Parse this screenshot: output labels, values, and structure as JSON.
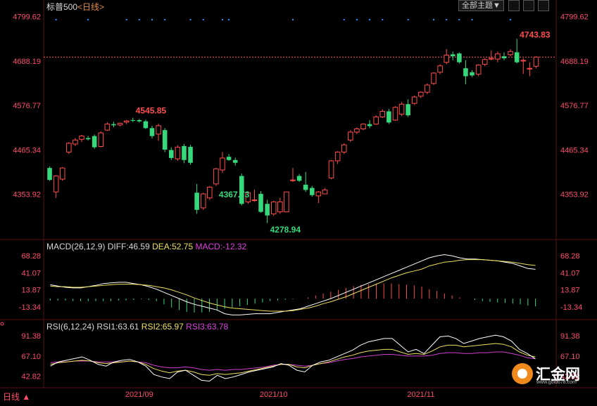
{
  "header": {
    "symbol": "标普500",
    "period_link": "<日线>",
    "theme_button": "全部主题▼"
  },
  "toolbar_icons": [
    "grid-icon",
    "settings-icon",
    "chart-icon"
  ],
  "price_panel": {
    "y_labels": [
      "4799.62",
      "4688.19",
      "4576.77",
      "4465.34",
      "4353.92"
    ],
    "annotations": {
      "high_1": "4545.85",
      "low_1": "4367.73",
      "low_2": "4278.94",
      "high_2": "4743.83"
    }
  },
  "macd_panel": {
    "title": "MACD(26,12,9)",
    "diff": "DIFF:46.59",
    "dea": "DEA:52.75",
    "macd": "MACD:-12.32",
    "y_labels": [
      "68.28",
      "41.07",
      "13.87",
      "-13.34"
    ]
  },
  "rsi_panel": {
    "title": "RSI(6,12,24)",
    "rsi1": "RSI1:63.61",
    "rsi2": "RSI2:65.97",
    "rsi3": "RSI3:63.78",
    "y_labels": [
      "91.38",
      "67.10",
      "42.82"
    ]
  },
  "x_axis": {
    "period": "日线",
    "labels": [
      "2021/09",
      "2021/10",
      "2021/11"
    ]
  },
  "watermark": {
    "name": "汇金网",
    "url": "www.gold678.com"
  },
  "colors": {
    "up": "#ff4d4d",
    "down": "#35d97c",
    "axis_text": "#ff4d6a",
    "diff_line": "#ffffff",
    "dea_line": "#f0e060",
    "macd_text": "#e040e0",
    "rsi3_line": "#d040d0",
    "ref_line": "#ff6060"
  },
  "chart_data": [
    {
      "type": "candlestick",
      "title": "标普500",
      "ylim": [
        4260,
        4820
      ],
      "reference_price": 4698,
      "candles": [
        {
          "o": 4420,
          "h": 4424,
          "l": 4388,
          "c": 4390
        },
        {
          "o": 4360,
          "h": 4402,
          "l": 4345,
          "c": 4400
        },
        {
          "o": 4392,
          "h": 4422,
          "l": 4388,
          "c": 4420
        },
        {
          "o": 4460,
          "h": 4485,
          "l": 4455,
          "c": 4482
        },
        {
          "o": 4480,
          "h": 4495,
          "l": 4475,
          "c": 4490
        },
        {
          "o": 4492,
          "h": 4503,
          "l": 4485,
          "c": 4500
        },
        {
          "o": 4495,
          "h": 4500,
          "l": 4489,
          "c": 4492
        },
        {
          "o": 4500,
          "h": 4504,
          "l": 4468,
          "c": 4472
        },
        {
          "o": 4474,
          "h": 4512,
          "l": 4472,
          "c": 4508
        },
        {
          "o": 4515,
          "h": 4535,
          "l": 4513,
          "c": 4530
        },
        {
          "o": 4530,
          "h": 4536,
          "l": 4522,
          "c": 4527
        },
        {
          "o": 4528,
          "h": 4534,
          "l": 4524,
          "c": 4532
        },
        {
          "o": 4535,
          "h": 4540,
          "l": 4530,
          "c": 4538
        },
        {
          "o": 4540,
          "h": 4546,
          "l": 4535,
          "c": 4539
        },
        {
          "o": 4540,
          "h": 4543,
          "l": 4534,
          "c": 4537
        },
        {
          "o": 4537,
          "h": 4541,
          "l": 4518,
          "c": 4520
        },
        {
          "o": 4520,
          "h": 4526,
          "l": 4494,
          "c": 4500
        },
        {
          "o": 4505,
          "h": 4531,
          "l": 4488,
          "c": 4526
        },
        {
          "o": 4515,
          "h": 4520,
          "l": 4460,
          "c": 4466
        },
        {
          "o": 4465,
          "h": 4472,
          "l": 4440,
          "c": 4445
        },
        {
          "o": 4443,
          "h": 4477,
          "l": 4438,
          "c": 4472
        },
        {
          "o": 4475,
          "h": 4480,
          "l": 4432,
          "c": 4440
        },
        {
          "o": 4473,
          "h": 4478,
          "l": 4428,
          "c": 4433
        },
        {
          "o": 4358,
          "h": 4380,
          "l": 4305,
          "c": 4315
        },
        {
          "o": 4320,
          "h": 4358,
          "l": 4315,
          "c": 4355
        },
        {
          "o": 4345,
          "h": 4375,
          "l": 4340,
          "c": 4372
        },
        {
          "o": 4380,
          "h": 4420,
          "l": 4375,
          "c": 4418
        },
        {
          "o": 4415,
          "h": 4460,
          "l": 4408,
          "c": 4445
        },
        {
          "o": 4448,
          "h": 4455,
          "l": 4438,
          "c": 4440
        },
        {
          "o": 4440,
          "h": 4446,
          "l": 4426,
          "c": 4433
        },
        {
          "o": 4400,
          "h": 4406,
          "l": 4326,
          "c": 4330
        },
        {
          "o": 4335,
          "h": 4362,
          "l": 4330,
          "c": 4358
        },
        {
          "o": 4340,
          "h": 4366,
          "l": 4335,
          "c": 4340
        },
        {
          "o": 4355,
          "h": 4362,
          "l": 4308,
          "c": 4310
        },
        {
          "o": 4330,
          "h": 4340,
          "l": 4282,
          "c": 4301
        },
        {
          "o": 4305,
          "h": 4338,
          "l": 4300,
          "c": 4335
        },
        {
          "o": 4310,
          "h": 4345,
          "l": 4305,
          "c": 4335
        },
        {
          "o": 4310,
          "h": 4360,
          "l": 4310,
          "c": 4360
        },
        {
          "o": 4390,
          "h": 4420,
          "l": 4385,
          "c": 4390
        },
        {
          "o": 4400,
          "h": 4405,
          "l": 4385,
          "c": 4388
        },
        {
          "o": 4378,
          "h": 4410,
          "l": 4360,
          "c": 4365
        },
        {
          "o": 4370,
          "h": 4375,
          "l": 4348,
          "c": 4352
        },
        {
          "o": 4350,
          "h": 4362,
          "l": 4332,
          "c": 4360
        },
        {
          "o": 4355,
          "h": 4370,
          "l": 4355,
          "c": 4365
        },
        {
          "o": 4395,
          "h": 4440,
          "l": 4392,
          "c": 4438
        },
        {
          "o": 4438,
          "h": 4462,
          "l": 4430,
          "c": 4460
        },
        {
          "o": 4460,
          "h": 4482,
          "l": 4455,
          "c": 4478
        },
        {
          "o": 4490,
          "h": 4515,
          "l": 4485,
          "c": 4510
        },
        {
          "o": 4510,
          "h": 4522,
          "l": 4505,
          "c": 4518
        },
        {
          "o": 4518,
          "h": 4532,
          "l": 4515,
          "c": 4530
        },
        {
          "o": 4530,
          "h": 4540,
          "l": 4520,
          "c": 4525
        },
        {
          "o": 4530,
          "h": 4552,
          "l": 4528,
          "c": 4548
        },
        {
          "o": 4548,
          "h": 4567,
          "l": 4545,
          "c": 4562
        },
        {
          "o": 4562,
          "h": 4568,
          "l": 4530,
          "c": 4534
        },
        {
          "o": 4540,
          "h": 4575,
          "l": 4538,
          "c": 4572
        },
        {
          "o": 4555,
          "h": 4585,
          "l": 4550,
          "c": 4580
        },
        {
          "o": 4580,
          "h": 4592,
          "l": 4548,
          "c": 4552
        },
        {
          "o": 4582,
          "h": 4602,
          "l": 4578,
          "c": 4598
        },
        {
          "o": 4600,
          "h": 4612,
          "l": 4595,
          "c": 4610
        },
        {
          "o": 4610,
          "h": 4632,
          "l": 4605,
          "c": 4628
        },
        {
          "o": 4632,
          "h": 4660,
          "l": 4628,
          "c": 4658
        },
        {
          "o": 4660,
          "h": 4680,
          "l": 4655,
          "c": 4676
        },
        {
          "o": 4685,
          "h": 4718,
          "l": 4680,
          "c": 4703
        },
        {
          "o": 4705,
          "h": 4712,
          "l": 4690,
          "c": 4700
        },
        {
          "o": 4707,
          "h": 4710,
          "l": 4682,
          "c": 4685
        },
        {
          "o": 4670,
          "h": 4690,
          "l": 4630,
          "c": 4650
        },
        {
          "o": 4660,
          "h": 4665,
          "l": 4648,
          "c": 4652
        },
        {
          "o": 4655,
          "h": 4680,
          "l": 4650,
          "c": 4678
        },
        {
          "o": 4680,
          "h": 4695,
          "l": 4675,
          "c": 4692
        },
        {
          "o": 4693,
          "h": 4715,
          "l": 4690,
          "c": 4695
        },
        {
          "o": 4693,
          "h": 4712,
          "l": 4685,
          "c": 4706
        },
        {
          "o": 4700,
          "h": 4710,
          "l": 4690,
          "c": 4695
        },
        {
          "o": 4704,
          "h": 4718,
          "l": 4700,
          "c": 4712
        },
        {
          "o": 4710,
          "h": 4744,
          "l": 4682,
          "c": 4685
        },
        {
          "o": 4688,
          "h": 4695,
          "l": 4656,
          "c": 4690
        },
        {
          "o": 4668,
          "h": 4685,
          "l": 4650,
          "c": 4670
        },
        {
          "o": 4675,
          "h": 4700,
          "l": 4670,
          "c": 4698
        }
      ]
    },
    {
      "type": "line+bar",
      "title": "MACD(26,12,9)",
      "ylim": [
        -30,
        75
      ],
      "series": [
        {
          "name": "DIFF",
          "values": [
            22,
            20,
            18,
            17,
            17,
            19,
            21,
            24,
            25,
            26,
            26,
            24,
            22,
            19,
            15,
            10,
            5,
            0,
            -5,
            -9,
            -12,
            -15,
            -18,
            -24,
            -26,
            -26,
            -25,
            -24,
            -24,
            -24,
            -22,
            -20,
            -18,
            -16,
            -12,
            -8,
            -4,
            0,
            5,
            10,
            15,
            20,
            25,
            30,
            35,
            40,
            45,
            50,
            55,
            60,
            65,
            68,
            70,
            68,
            65,
            63,
            63,
            62,
            61,
            60,
            58,
            56,
            52,
            48,
            46.59
          ]
        },
        {
          "name": "DEA",
          "values": [
            20,
            19,
            19,
            18,
            18,
            19,
            20,
            21,
            22,
            23,
            23,
            23,
            22,
            21,
            19,
            17,
            14,
            10,
            6,
            1,
            -3,
            -7,
            -10,
            -13,
            -15,
            -16,
            -17,
            -18,
            -19,
            -20,
            -20,
            -20,
            -19,
            -17,
            -15,
            -12,
            -8,
            -5,
            -1,
            3,
            8,
            13,
            18,
            23,
            28,
            33,
            37,
            41,
            44,
            47,
            52,
            55,
            58,
            59,
            61,
            62,
            62,
            62,
            61,
            60,
            59,
            58,
            56,
            54,
            52.75
          ]
        },
        {
          "name": "MACD",
          "values": [
            -3,
            -3,
            -3,
            -4,
            -4,
            -4,
            -4,
            -4,
            -4,
            -3,
            -3,
            -2,
            -1,
            -2,
            -4,
            -9,
            -14,
            -18,
            -21,
            -22,
            -22,
            -21,
            -19,
            -16,
            -14,
            -12,
            -10,
            -8,
            -6,
            -4,
            -3,
            -2,
            -1,
            0,
            2,
            5,
            8,
            11,
            14,
            17,
            20,
            22,
            23,
            24,
            24,
            24,
            23,
            22,
            21,
            19,
            15,
            12,
            8,
            5,
            2,
            0,
            -2,
            -4,
            -5,
            -6,
            -7,
            -8,
            -9,
            -11,
            -12.32
          ]
        }
      ]
    },
    {
      "type": "line",
      "title": "RSI(6,12,24)",
      "ylim": [
        35,
        98
      ],
      "series": [
        {
          "name": "RSI1",
          "values": [
            55,
            60,
            62,
            64,
            66,
            62,
            57,
            55,
            60,
            62,
            63,
            60,
            55,
            45,
            42,
            40,
            48,
            50,
            44,
            38,
            37,
            44,
            40,
            42,
            45,
            48,
            50,
            52,
            54,
            58,
            56,
            50,
            48,
            56,
            60,
            62,
            66,
            70,
            74,
            80,
            84,
            86,
            88,
            88,
            80,
            72,
            75,
            70,
            80,
            90,
            91,
            88,
            82,
            85,
            88,
            90,
            92,
            90,
            85,
            75,
            70,
            63.61
          ]
        },
        {
          "name": "RSI2",
          "values": [
            57,
            59,
            60,
            61,
            62,
            61,
            59,
            58,
            59,
            60,
            61,
            60,
            57,
            52,
            49,
            47,
            49,
            50,
            48,
            45,
            44,
            46,
            45,
            46,
            47,
            49,
            51,
            53,
            55,
            57,
            57,
            54,
            53,
            56,
            58,
            60,
            63,
            66,
            68,
            71,
            73,
            74,
            75,
            75,
            72,
            69,
            70,
            69,
            73,
            78,
            80,
            80,
            78,
            79,
            80,
            81,
            82,
            81,
            78,
            72,
            68,
            65.97
          ]
        },
        {
          "name": "RSI3",
          "values": [
            59,
            60,
            60,
            61,
            61,
            61,
            60,
            60,
            60,
            60,
            61,
            60,
            59,
            56,
            54,
            53,
            53,
            54,
            53,
            51,
            50,
            51,
            50,
            51,
            51,
            52,
            53,
            54,
            56,
            57,
            57,
            56,
            55,
            56,
            58,
            59,
            61,
            63,
            64,
            66,
            67,
            68,
            69,
            69,
            68,
            67,
            67,
            67,
            68,
            70,
            71,
            71,
            70,
            70,
            71,
            71,
            72,
            72,
            70,
            68,
            65,
            63.78
          ]
        }
      ]
    }
  ]
}
